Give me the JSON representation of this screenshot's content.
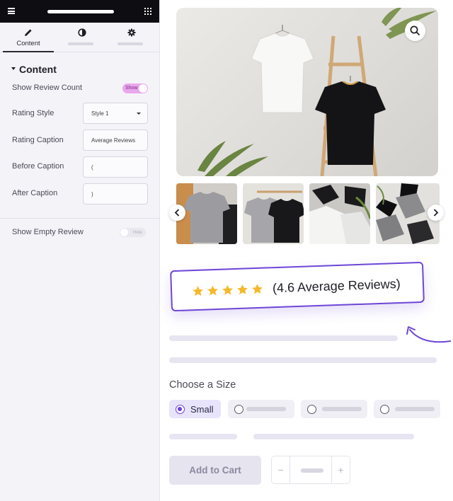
{
  "panel": {
    "tabs": [
      {
        "label": "Content",
        "icon": "pencil-icon",
        "active": true
      },
      {
        "label": "",
        "icon": "half-circle-icon",
        "active": false
      },
      {
        "label": "",
        "icon": "gear-icon",
        "active": false
      }
    ],
    "section_title": "Content",
    "fields": {
      "show_review_count": {
        "label": "Show Review Count",
        "toggle_text": "Show",
        "on": true
      },
      "rating_style": {
        "label": "Rating Style",
        "value": "Style 1"
      },
      "rating_caption": {
        "label": "Rating Caption",
        "value": "Average Reviews"
      },
      "before_caption": {
        "label": "Before Caption",
        "value": "("
      },
      "after_caption": {
        "label": "After Caption",
        "value": ")"
      },
      "show_empty_review": {
        "label": "Show Empty Review",
        "toggle_text": "Hide",
        "on": false
      }
    }
  },
  "product": {
    "review": {
      "stars": 5,
      "text": "(4.6 Average Reviews)"
    },
    "size_title": "Choose a Size",
    "sizes": [
      {
        "label": "Small",
        "selected": true
      }
    ],
    "add_to_cart": "Add to Cart",
    "qty_minus": "−",
    "qty_plus": "+"
  },
  "colors": {
    "accent": "#6e46d6",
    "star": "#f5b82a",
    "toggle_on": "#e9a7ec"
  }
}
